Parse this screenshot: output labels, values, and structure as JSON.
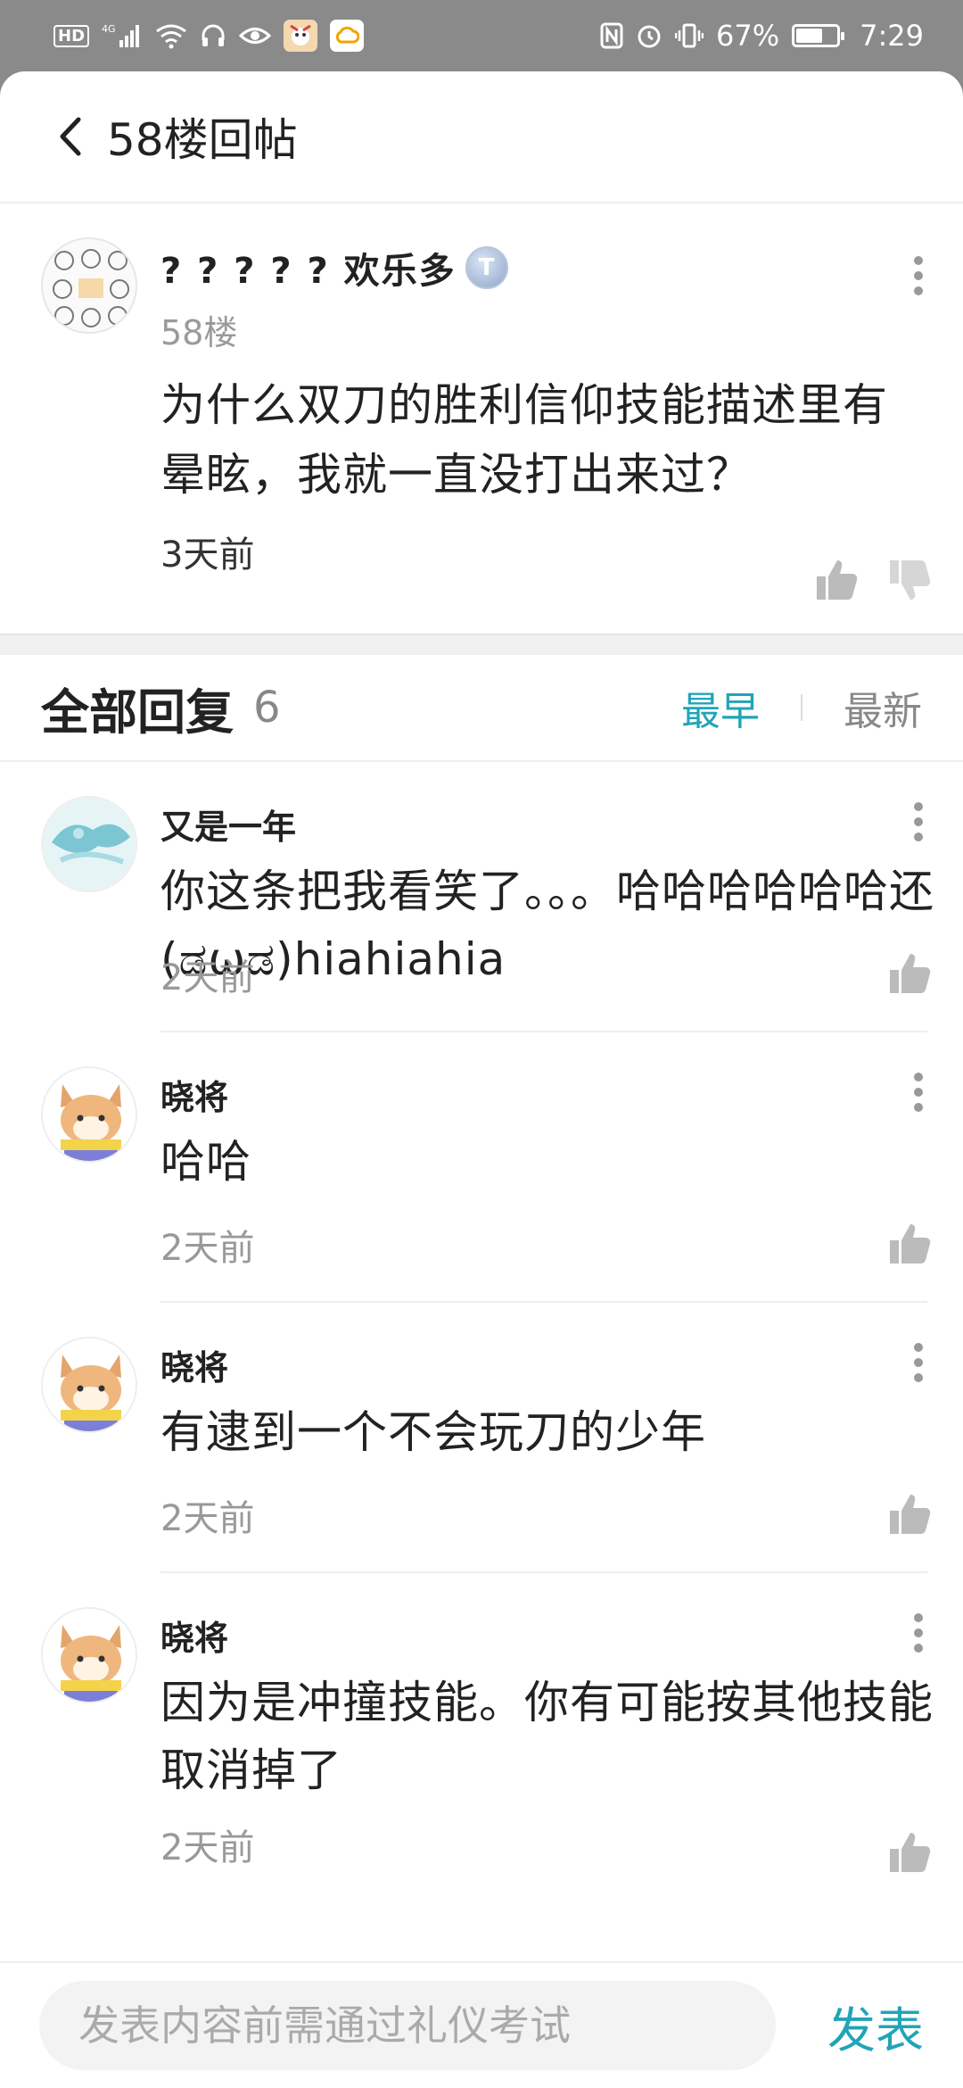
{
  "status_bar": {
    "left_icons": [
      "hd-icon",
      "signal-icon",
      "wifi-icon",
      "headset-icon",
      "eye-icon",
      "app-notification-icon",
      "cloud-app-icon"
    ],
    "hd_label": "HD",
    "signal_label": "4G",
    "battery_percent": "67%",
    "battery_level": 0.67,
    "time": "7:29",
    "right_icons": [
      "nfc-icon",
      "alarm-icon",
      "vibrate-icon",
      "battery-icon"
    ]
  },
  "header": {
    "title": "58楼回帖"
  },
  "post": {
    "username": "? ? ? ? ? 欢乐多",
    "level_badge": "T",
    "floor": "58楼",
    "content": "为什么双刀的胜利信仰技能描述里有晕眩，我就一直没打出来过？",
    "time": "3天前"
  },
  "replies_section": {
    "title": "全部回复",
    "count": "6",
    "sort_earliest": "最早",
    "sort_latest": "最新"
  },
  "replies": [
    {
      "name": "又是一年",
      "content": "你这条把我看笑了。。。哈哈哈哈哈哈还(ಡωಡ)hiahiahia",
      "time": "2天前"
    },
    {
      "name": "晓将",
      "content": "哈哈",
      "time": "2天前"
    },
    {
      "name": "晓将",
      "content": "有逮到一个不会玩刀的少年",
      "time": "2天前"
    },
    {
      "name": "晓将",
      "content": "因为是冲撞技能。你有可能按其他技能取消掉了",
      "time": "2天前"
    }
  ],
  "composer": {
    "placeholder": "发表内容前需通过礼仪考试",
    "send_label": "发表"
  },
  "colors": {
    "accent": "#21a4b8",
    "status_bar_bg": "#8a8a8a"
  }
}
